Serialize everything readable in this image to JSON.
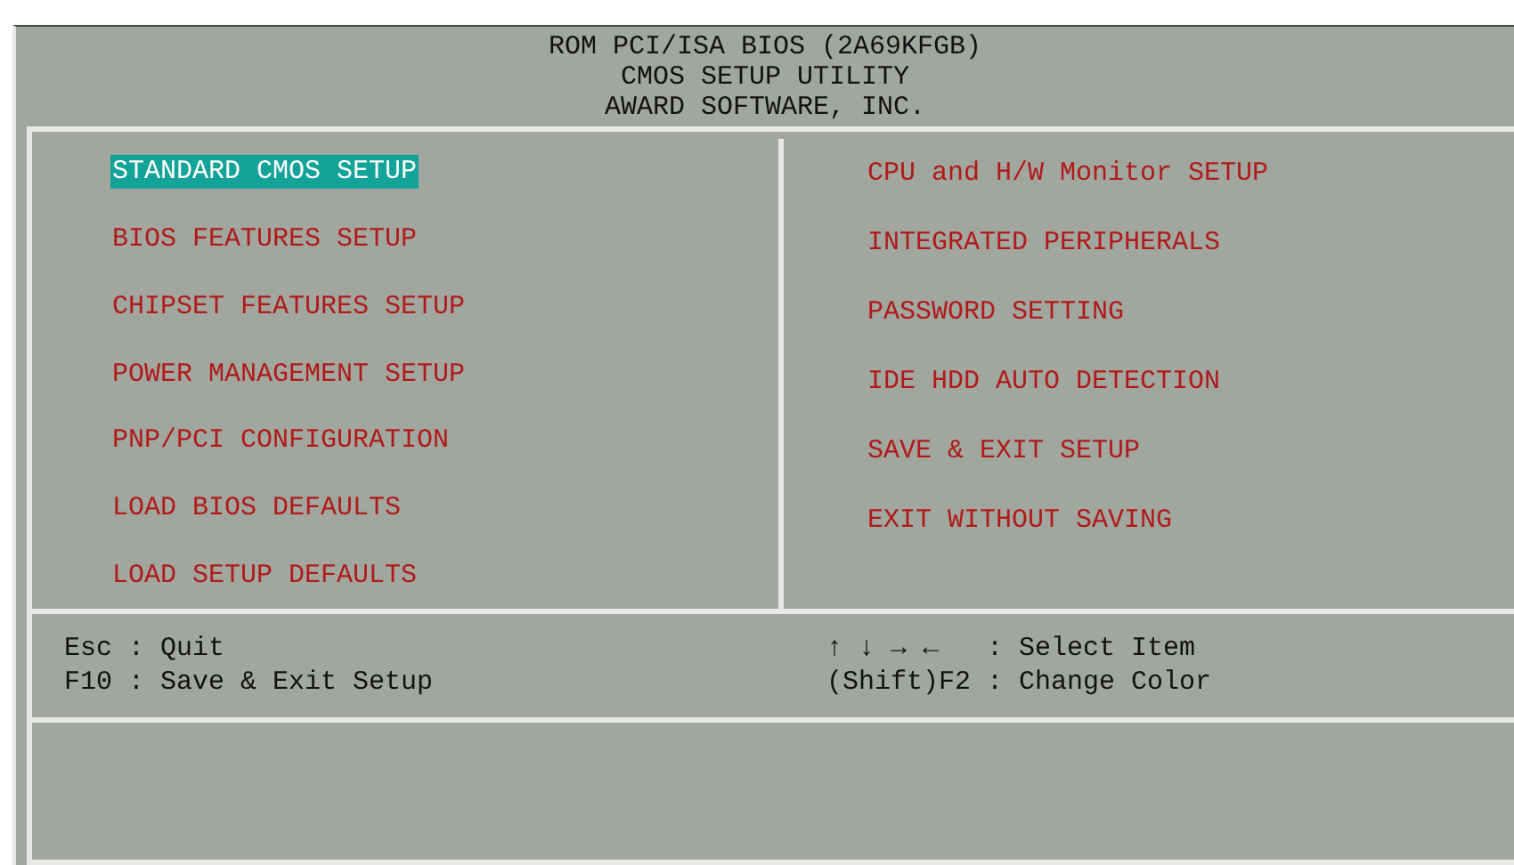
{
  "header": [
    "ROM PCI/ISA BIOS (2A69KFGB)",
    "CMOS SETUP UTILITY",
    "AWARD SOFTWARE, INC."
  ],
  "menu_left": [
    {
      "label": "STANDARD CMOS SETUP",
      "selected": true
    },
    {
      "label": "BIOS FEATURES SETUP",
      "selected": false
    },
    {
      "label": "CHIPSET FEATURES SETUP",
      "selected": false
    },
    {
      "label": "POWER MANAGEMENT SETUP",
      "selected": false
    },
    {
      "label": "PNP/PCI CONFIGURATION",
      "selected": false
    },
    {
      "label": "LOAD BIOS DEFAULTS",
      "selected": false
    },
    {
      "label": "LOAD SETUP DEFAULTS",
      "selected": false
    }
  ],
  "menu_right": [
    {
      "label": "CPU and H/W Monitor SETUP",
      "selected": false
    },
    {
      "label": "INTEGRATED PERIPHERALS",
      "selected": false
    },
    {
      "label": "PASSWORD SETTING",
      "selected": false
    },
    {
      "label": "IDE HDD AUTO DETECTION",
      "selected": false
    },
    {
      "label": "SAVE & EXIT SETUP",
      "selected": false
    },
    {
      "label": "EXIT WITHOUT SAVING",
      "selected": false
    }
  ],
  "help_left": [
    "Esc : Quit",
    "F10 : Save & Exit Setup"
  ],
  "help_right": [
    "↑ ↓ → ←   : Select Item",
    "(Shift)F2 : Change Color"
  ]
}
